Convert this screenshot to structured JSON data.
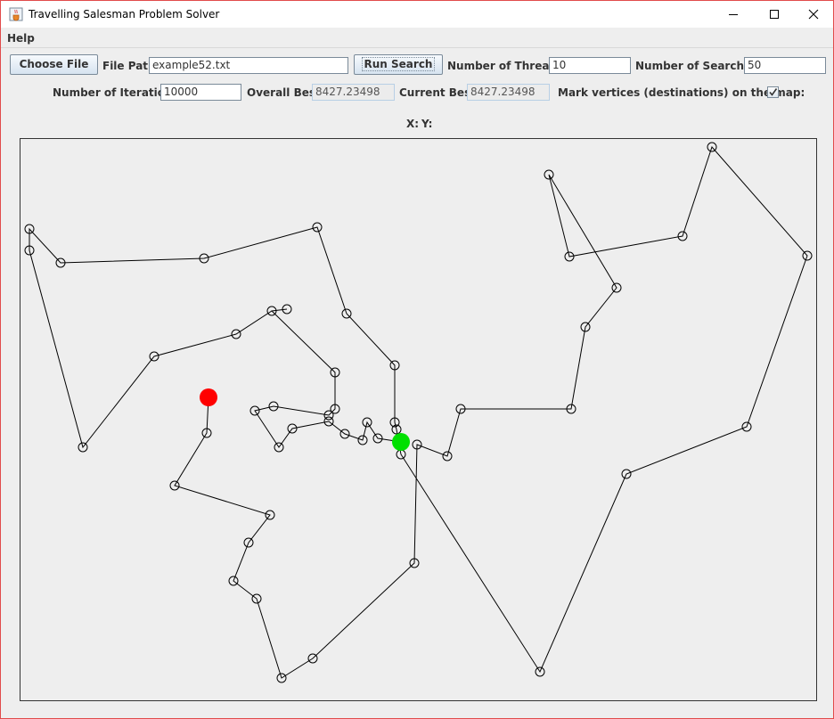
{
  "window": {
    "title": "Travelling Salesman Problem Solver",
    "controls": [
      "minimize",
      "maximize",
      "close"
    ]
  },
  "menu": {
    "help": "Help"
  },
  "toolbar": {
    "choose_file": "Choose File",
    "file_path_label": "File Path",
    "file_path_value": "example52.txt",
    "run_search": "Run Search",
    "threads_label": "Number of Threads",
    "threads_value": "10",
    "searches_label": "Number of Searches",
    "searches_value": "50",
    "iterations_label": "Number of Iterations",
    "iterations_value": "10000",
    "overall_best_label": "Overall Best",
    "overall_best_value": "8427.23498",
    "current_best_label": "Current Best",
    "current_best_value": "8427.23498",
    "mark_vertices_label": "Mark vertices (destinations) on the map:",
    "mark_vertices_checked": true
  },
  "coords": {
    "x_label": "X:",
    "y_label": "Y:"
  },
  "map": {
    "colors": {
      "start": "#ff0000",
      "current": "#00e000",
      "line": "#000000"
    },
    "start_vertex": [
      233,
      445
    ],
    "current_vertex": [
      449,
      495
    ],
    "tour": [
      [
        233,
        445
      ],
      [
        231,
        485
      ],
      [
        195,
        544
      ],
      [
        302,
        577
      ],
      [
        278,
        608
      ],
      [
        261,
        651
      ],
      [
        287,
        671
      ],
      [
        315,
        760
      ],
      [
        350,
        738
      ],
      [
        464,
        631
      ],
      [
        467,
        498
      ],
      [
        501,
        511
      ],
      [
        516,
        458
      ],
      [
        640,
        458
      ],
      [
        656,
        366
      ],
      [
        691,
        322
      ],
      [
        615,
        195
      ],
      [
        638,
        287
      ],
      [
        765,
        264
      ],
      [
        798,
        164
      ],
      [
        905,
        286
      ],
      [
        837,
        478
      ],
      [
        702,
        531
      ],
      [
        605,
        753
      ],
      [
        449,
        509
      ],
      [
        444,
        481
      ],
      [
        442,
        473
      ],
      [
        442,
        409
      ],
      [
        388,
        351
      ],
      [
        355,
        254
      ],
      [
        228,
        289
      ],
      [
        67,
        294
      ],
      [
        32,
        256
      ],
      [
        32,
        280
      ],
      [
        92,
        501
      ],
      [
        172,
        399
      ],
      [
        264,
        374
      ],
      [
        304,
        348
      ],
      [
        321,
        346
      ],
      [
        304,
        348
      ],
      [
        375,
        417
      ],
      [
        375,
        458
      ],
      [
        368,
        465
      ],
      [
        306,
        455
      ],
      [
        285,
        460
      ],
      [
        312,
        501
      ],
      [
        327,
        480
      ],
      [
        368,
        472
      ],
      [
        386,
        486
      ],
      [
        406,
        493
      ],
      [
        411,
        473
      ],
      [
        423,
        491
      ],
      [
        449,
        495
      ]
    ]
  }
}
